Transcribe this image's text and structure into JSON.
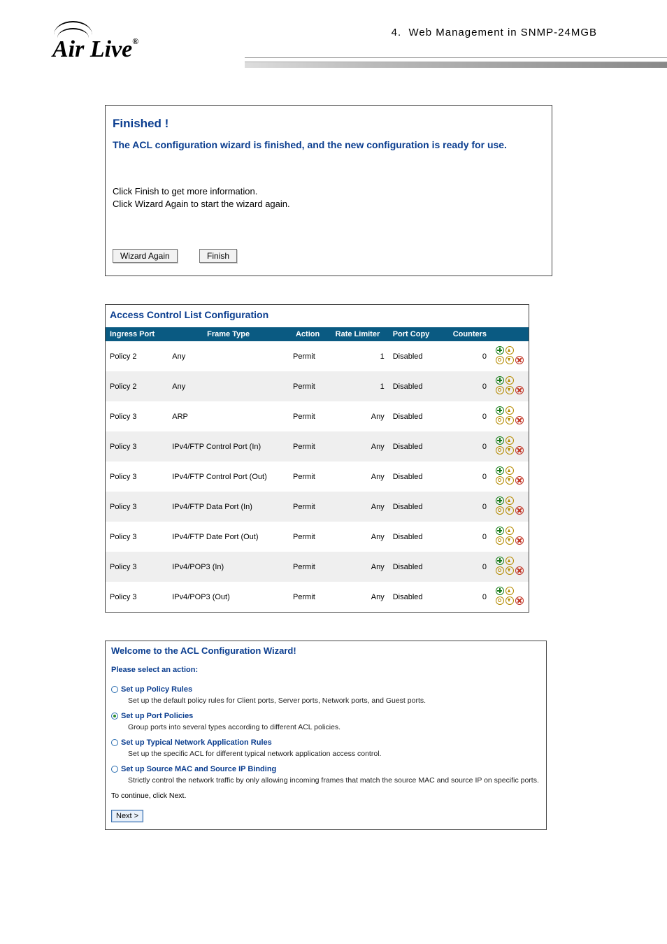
{
  "header": {
    "logo_text": "Air Live",
    "logo_reg": "®",
    "breadcrumb_num": "4.",
    "breadcrumb_text": "Web Management in SNMP-24MGB"
  },
  "panel_finished": {
    "title": "Finished !",
    "subtitle": "The ACL configuration wizard is finished, and the new configuration is ready for use.",
    "info_line1": "Click Finish to get more information.",
    "info_line2": "Click Wizard Again to start the wizard again.",
    "btn_wizard_again": "Wizard Again",
    "btn_finish": "Finish"
  },
  "acl": {
    "title": "Access Control List Configuration",
    "columns": {
      "ingress_port": "Ingress Port",
      "frame_type": "Frame Type",
      "action": "Action",
      "rate_limiter": "Rate Limiter",
      "port_copy": "Port Copy",
      "counters": "Counters"
    },
    "rows": [
      {
        "ingress_port": "Policy 2",
        "frame_type": "Any",
        "action": "Permit",
        "rate_limiter": "1",
        "port_copy": "Disabled",
        "counters": "0"
      },
      {
        "ingress_port": "Policy 2",
        "frame_type": "Any",
        "action": "Permit",
        "rate_limiter": "1",
        "port_copy": "Disabled",
        "counters": "0"
      },
      {
        "ingress_port": "Policy 3",
        "frame_type": "ARP",
        "action": "Permit",
        "rate_limiter": "Any",
        "port_copy": "Disabled",
        "counters": "0"
      },
      {
        "ingress_port": "Policy 3",
        "frame_type": "IPv4/FTP Control Port (In)",
        "action": "Permit",
        "rate_limiter": "Any",
        "port_copy": "Disabled",
        "counters": "0"
      },
      {
        "ingress_port": "Policy 3",
        "frame_type": "IPv4/FTP Control Port (Out)",
        "action": "Permit",
        "rate_limiter": "Any",
        "port_copy": "Disabled",
        "counters": "0"
      },
      {
        "ingress_port": "Policy 3",
        "frame_type": "IPv4/FTP Data Port (In)",
        "action": "Permit",
        "rate_limiter": "Any",
        "port_copy": "Disabled",
        "counters": "0"
      },
      {
        "ingress_port": "Policy 3",
        "frame_type": "IPv4/FTP Date Port (Out)",
        "action": "Permit",
        "rate_limiter": "Any",
        "port_copy": "Disabled",
        "counters": "0"
      },
      {
        "ingress_port": "Policy 3",
        "frame_type": "IPv4/POP3 (In)",
        "action": "Permit",
        "rate_limiter": "Any",
        "port_copy": "Disabled",
        "counters": "0"
      },
      {
        "ingress_port": "Policy 3",
        "frame_type": "IPv4/POP3 (Out)",
        "action": "Permit",
        "rate_limiter": "Any",
        "port_copy": "Disabled",
        "counters": "0"
      }
    ]
  },
  "wizard": {
    "title": "Welcome to the ACL Configuration Wizard!",
    "prompt": "Please select an action:",
    "options": [
      {
        "selected": false,
        "title": "Set up Policy Rules",
        "desc": "Set up the default policy rules for Client ports, Server ports, Network ports, and Guest ports."
      },
      {
        "selected": true,
        "title": "Set up Port Policies",
        "desc": "Group ports into several types according to different ACL policies."
      },
      {
        "selected": false,
        "title": "Set up Typical Network Application Rules",
        "desc": "Set up the specific ACL for different typical network application access control."
      },
      {
        "selected": false,
        "title": "Set up Source MAC and Source IP Binding",
        "desc": "Strictly control the network traffic by only allowing incoming frames that match the source MAC and source IP on specific ports."
      }
    ],
    "continue_text": "To continue, click Next.",
    "next_label": "Next >"
  }
}
